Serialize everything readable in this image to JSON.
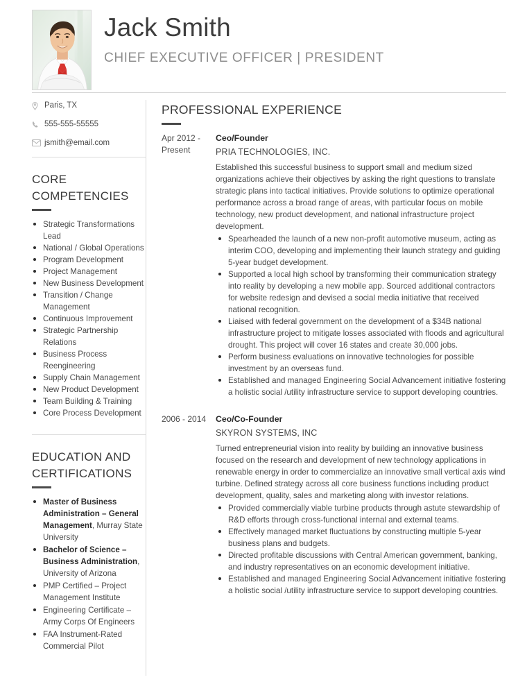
{
  "header": {
    "full_name": "Jack Smith",
    "job_headline": "CHIEF EXECUTIVE OFFICER | PRESIDENT",
    "photo_alt": "portrait-photo"
  },
  "contact": {
    "location": "Paris, TX",
    "phone": "555-555-55555",
    "email": "jsmith@email.com",
    "icons": {
      "location": "map-pin-icon",
      "phone": "phone-icon",
      "email": "envelope-icon"
    }
  },
  "core_competencies": {
    "title": "CORE COMPETENCIES",
    "items": [
      "Strategic Transformations Lead",
      "National / Global Operations",
      "Program Development",
      "Project Management",
      "New Business Development",
      "Transition / Change Management",
      "Continuous Improvement",
      "Strategic Partnership Relations",
      "Business Process Reengineering",
      "Supply Chain Management",
      "New Product Development",
      "Team Building & Training",
      "Core Process Development"
    ]
  },
  "education": {
    "title": "EDUCATION AND CERTIFICATIONS",
    "items": [
      {
        "bold": "Master of Business Administration – General Management",
        "rest": ", Murray State University"
      },
      {
        "bold": "Bachelor of Science – Business Administration",
        "rest": ", University of Arizona"
      },
      {
        "bold": "",
        "rest": "PMP Certified – Project Management Institute"
      },
      {
        "bold": "",
        "rest": "Engineering Certificate – Army Corps Of Engineers"
      },
      {
        "bold": "",
        "rest": "FAA Instrument-Rated Commercial Pilot"
      }
    ]
  },
  "experience": {
    "title": "PROFESSIONAL EXPERIENCE",
    "jobs": [
      {
        "dates": "Apr 2012 - Present",
        "title": "Ceo/Founder",
        "company": "PRIA TECHNOLOGIES, INC.",
        "summary": "Established this successful business to support small and medium sized organizations achieve their objectives by asking the right questions to translate strategic plans into tactical initiatives. Provide solutions to optimize operational performance across a broad range of areas, with particular focus on mobile technology, new product development, and national infrastructure project development.",
        "bullets": [
          "Spearheaded the launch of a new non-profit automotive museum, acting as interim COO, developing and implementing their launch strategy and guiding 5-year budget development.",
          "Supported a local high school by transforming their communication strategy into reality by developing a new mobile app. Sourced additional contractors for website redesign and devised a social media initiative that received national recognition.",
          "Liaised with federal government on the development of a $34B national infrastructure project to mitigate losses associated with floods and agricultural drought. This project will cover 16 states and create 30,000 jobs.",
          "Perform business evaluations on innovative technologies for possible investment by an overseas fund.",
          "Established and managed Engineering Social Advancement initiative fostering a holistic social /utility infrastructure service to support developing countries."
        ]
      },
      {
        "dates": "2006 - 2014",
        "title": "Ceo/Co-Founder",
        "company": "SKYRON SYSTEMS, INC",
        "summary": "Turned entrepreneurial vision into reality by building an innovative business focused on the research and development of new technology applications in renewable energy in order to commercialize an innovative small vertical axis wind turbine. Defined strategy across all core business functions including product development, quality, sales and marketing along with investor relations.",
        "bullets": [
          "Provided commercially viable turbine products through astute stewardship of R&D efforts through cross-functional internal and external teams.",
          "Effectively managed market fluctuations by constructing multiple 5-year business plans and budgets.",
          "Directed profitable discussions with Central American government, banking, and industry representatives on an economic development initiative.",
          "Established and managed Engineering Social Advancement initiative fostering a holistic social /utility infrastructure service to support developing countries."
        ]
      }
    ]
  },
  "colors": {
    "text": "#4a4a4a",
    "heading": "#3a3a3a",
    "muted": "#8e8e8e",
    "rule": "#d8d8d8",
    "accent_underline": "#4a4a4a",
    "tie_red": "#d8352f"
  }
}
